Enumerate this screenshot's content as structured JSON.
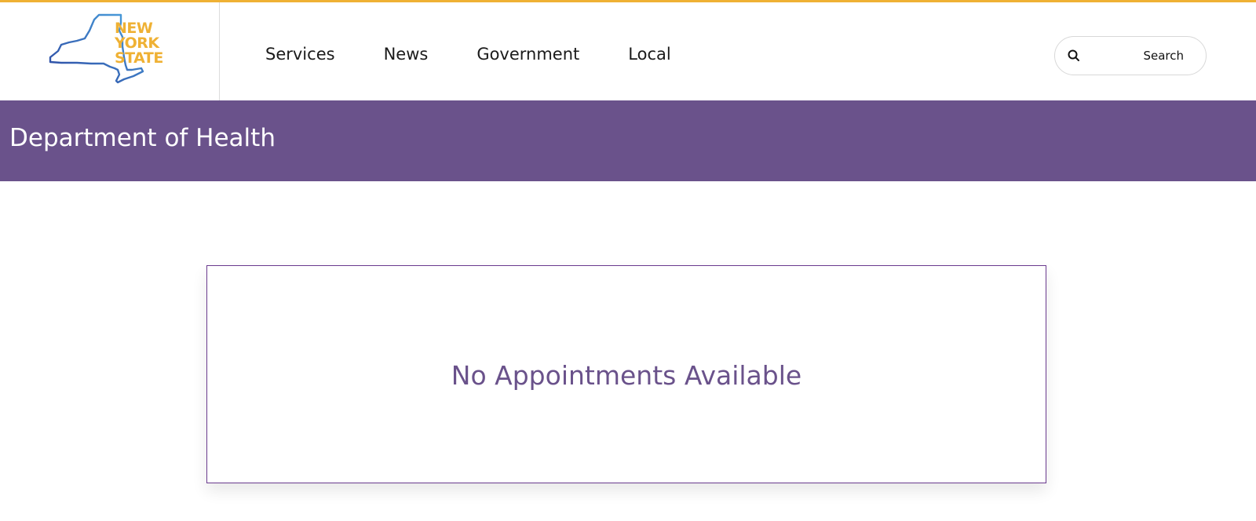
{
  "logo": {
    "lines": [
      "NEW",
      "YORK",
      "STATE"
    ],
    "alt": "New York State"
  },
  "nav": {
    "items": [
      "Services",
      "News",
      "Government",
      "Local"
    ]
  },
  "search": {
    "label": "Search",
    "icon": "search-icon"
  },
  "banner": {
    "title": "Department of Health"
  },
  "main": {
    "message": "No Appointments Available"
  },
  "colors": {
    "accent_gold": "#efb134",
    "brand_purple": "#6a528b",
    "logo_blue": "#2a67b3"
  }
}
